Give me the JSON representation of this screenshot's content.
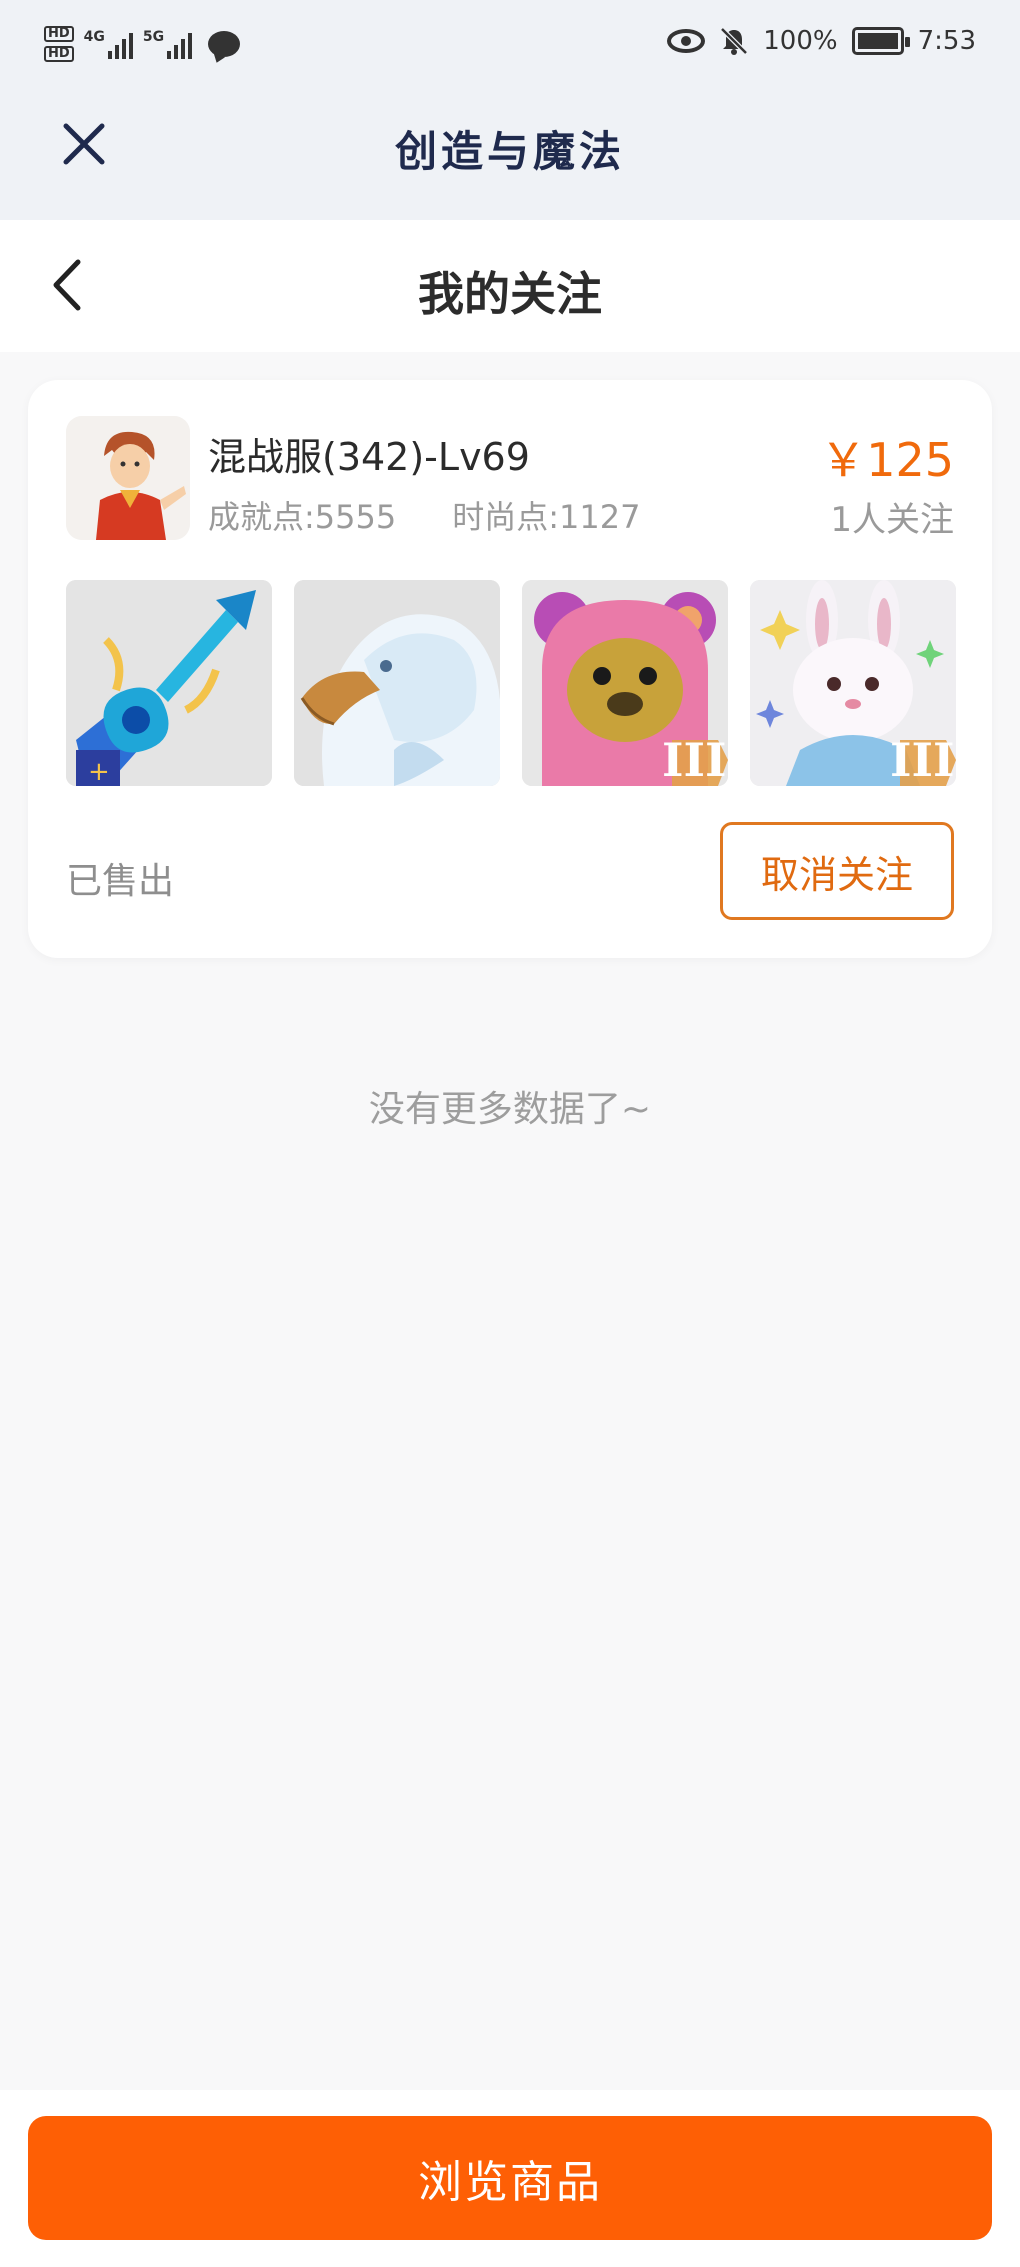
{
  "status_bar": {
    "hd1": "HD",
    "hd2": "HD",
    "net1": "4G",
    "net2": "5G",
    "battery_text": "100%",
    "time": "7:53",
    "icons": [
      "signal-icon",
      "chat-icon",
      "eye-icon",
      "bell-off-icon",
      "battery-icon"
    ]
  },
  "app_bar": {
    "title": "创造与魔法",
    "close_icon": "close-icon"
  },
  "header": {
    "title": "我的关注",
    "back_icon": "chevron-left-icon"
  },
  "card": {
    "server_name": "混战服(342)-Lv69",
    "achievement": "成就点:5555",
    "fashion": "时尚点:1127",
    "price": "￥125",
    "followers": "1人关注",
    "thumbnails": [
      "blue-guitar-weapon",
      "white-griffin-mount",
      "pink-bear-pet",
      "white-rabbit-pet"
    ],
    "status": "已售出",
    "unfollow_label": "取消关注"
  },
  "list_end_text": "没有更多数据了~",
  "browse_label": "浏览商品",
  "colors": {
    "accent": "#fe5f05",
    "price": "#f06a0c",
    "title_navy": "#1f2a4d"
  }
}
